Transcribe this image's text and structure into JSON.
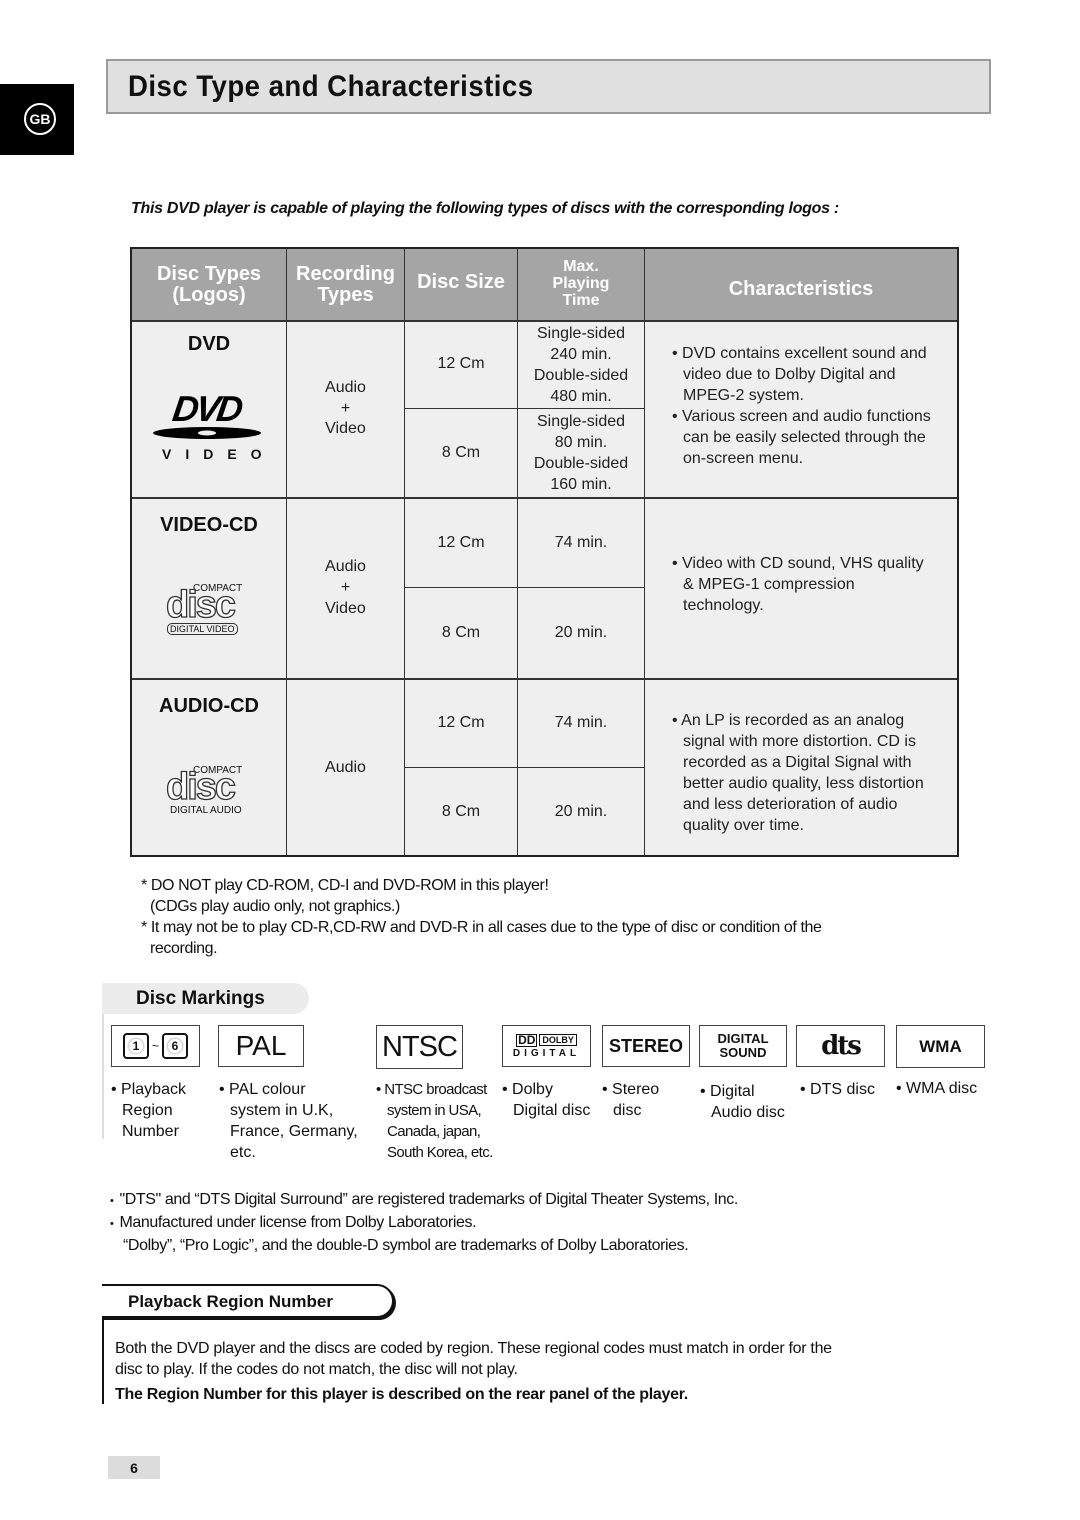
{
  "side_tab": {
    "label": "GB"
  },
  "header": {
    "title": "Disc Type and Characteristics"
  },
  "intro": "This DVD player is capable of playing the following types of discs with the corresponding logos :",
  "table": {
    "headers": {
      "disc_types": [
        "Disc Types",
        "(Logos)"
      ],
      "recording_types": [
        "Recording",
        "Types"
      ],
      "disc_size": "Disc Size",
      "max_playing_time": [
        "Max.",
        "Playing",
        "Time"
      ],
      "characteristics": "Characteristics"
    },
    "rows": [
      {
        "disc_type": "DVD",
        "logo": {
          "name": "dvd-video-logo",
          "text": "VIDEO"
        },
        "recording": [
          "Audio",
          "+",
          "Video"
        ],
        "sizes": [
          {
            "size": "12 Cm",
            "time": [
              "Single-sided",
              "240 min.",
              "Double-sided",
              "480 min."
            ]
          },
          {
            "size": "8 Cm",
            "time": [
              "Single-sided",
              "80 min.",
              "Double-sided",
              "160 min."
            ]
          }
        ],
        "characteristics": [
          "DVD contains excellent sound and video due to Dolby Digital and MPEG-2 system.",
          "Various screen and audio functions can be easily selected through the on-screen menu."
        ]
      },
      {
        "disc_type": "VIDEO-CD",
        "logo": {
          "name": "compact-disc-digital-video-logo",
          "top": "COMPACT",
          "mid": "disc",
          "bottom": "DIGITAL VIDEO"
        },
        "recording": [
          "Audio",
          "+",
          "Video"
        ],
        "sizes": [
          {
            "size": "12 Cm",
            "time": [
              "74 min."
            ]
          },
          {
            "size": "8 Cm",
            "time": [
              "20 min."
            ]
          }
        ],
        "characteristics": [
          "Video with CD sound, VHS quality & MPEG-1 compression technology."
        ]
      },
      {
        "disc_type": "AUDIO-CD",
        "logo": {
          "name": "compact-disc-digital-audio-logo",
          "top": "COMPACT",
          "mid": "disc",
          "bottom": "DIGITAL AUDIO"
        },
        "recording": [
          "Audio"
        ],
        "sizes": [
          {
            "size": "12 Cm",
            "time": [
              "74 min."
            ]
          },
          {
            "size": "8 Cm",
            "time": [
              "20 min."
            ]
          }
        ],
        "characteristics": [
          "An LP is recorded as an analog signal with more distortion. CD is recorded as a Digital Signal with better audio quality, less distortion and less deterioration of audio quality over time."
        ]
      }
    ]
  },
  "notes": [
    "* DO NOT play CD-ROM, CD-I and DVD-ROM in this player!",
    "(CDGs play audio only, not graphics.)",
    "* It may not be to play CD-R,CD-RW and DVD-R in all cases due to the type of disc or condition of the",
    "recording."
  ],
  "disc_markings": {
    "title": "Disc Markings",
    "items": [
      {
        "logo": "1 ~ 6",
        "region_from": "1",
        "region_to": "6",
        "label": [
          "Playback",
          "Region",
          "Number"
        ]
      },
      {
        "logo": "PAL",
        "label": [
          "PAL colour",
          "system in U.K,",
          "France, Germany,",
          "etc."
        ]
      },
      {
        "logo": "NTSC",
        "label": [
          "NTSC broadcast",
          "system in USA,",
          "Canada, japan,",
          "South Korea, etc."
        ]
      },
      {
        "logo": "DOLBY DIGITAL",
        "logo_top": "DOLBY",
        "logo_bottom": "DIGITAL",
        "label": [
          "Dolby",
          "Digital disc"
        ]
      },
      {
        "logo": "STEREO",
        "label": [
          "Stereo",
          "disc"
        ]
      },
      {
        "logo": "DIGITAL SOUND",
        "logo_top": "DIGITAL",
        "logo_bottom": "SOUND",
        "label": [
          "Digital",
          "Audio disc"
        ]
      },
      {
        "logo": "dts",
        "label": [
          "DTS disc"
        ]
      },
      {
        "logo": "WMA",
        "label": [
          "WMA disc"
        ]
      }
    ]
  },
  "trademarks": [
    "\"DTS\" and “DTS Digital Surround” are registered trademarks of Digital Theater Systems, Inc.",
    "Manufactured under license from Dolby Laboratories.",
    "“Dolby”, “Pro Logic”, and the double-D symbol are trademarks of Dolby Laboratories."
  ],
  "playback_region": {
    "title": "Playback Region Number",
    "body": "Both the DVD player and the discs are coded by region. These regional codes must match in order for the disc to play. If the codes do not match, the disc will not play.",
    "body_line1": "Both the DVD player and the discs are coded by region. These regional codes must match in order for the",
    "body_line2": "disc to play. If the codes do not match, the disc will not play.",
    "bold": "The Region Number for this player is described on the rear panel of the player."
  },
  "page_number": "6"
}
